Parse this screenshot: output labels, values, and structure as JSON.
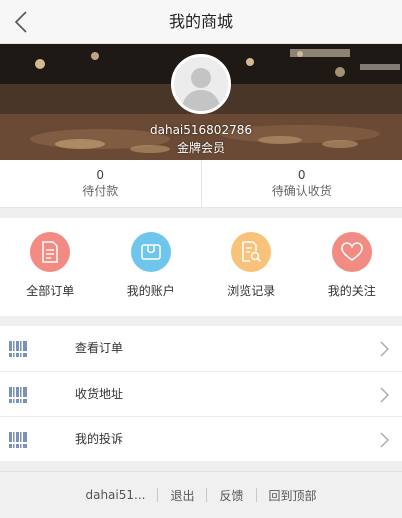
{
  "header": {
    "title": "我的商城",
    "back_icon": "chevron-left-icon"
  },
  "profile": {
    "username": "dahai516802786",
    "member_level": "金牌会员",
    "avatar_icon": "user-avatar-icon"
  },
  "stats": [
    {
      "count": "0",
      "label": "待付款"
    },
    {
      "count": "0",
      "label": "待确认收货"
    }
  ],
  "shortcuts": [
    {
      "label": "全部订单",
      "icon": "document-icon",
      "color": "#f28b82"
    },
    {
      "label": "我的账户",
      "icon": "wallet-icon",
      "color": "#6ec6ec"
    },
    {
      "label": "浏览记录",
      "icon": "history-search-icon",
      "color": "#f9c27a"
    },
    {
      "label": "我的关注",
      "icon": "heart-icon",
      "color": "#f28b82"
    }
  ],
  "menu": [
    {
      "label": "查看订单",
      "icon": "barcode-icon"
    },
    {
      "label": "收货地址",
      "icon": "barcode-icon"
    },
    {
      "label": "我的投诉",
      "icon": "barcode-icon"
    }
  ],
  "footer": {
    "user": "dahai51...",
    "logout": "退出",
    "feedback": "反馈",
    "back_to_top": "回到顶部"
  },
  "colors": {
    "accent_red": "#f28b82",
    "accent_blue": "#6ec6ec",
    "accent_orange": "#f9c27a",
    "list_icon": "#7b92b8"
  }
}
